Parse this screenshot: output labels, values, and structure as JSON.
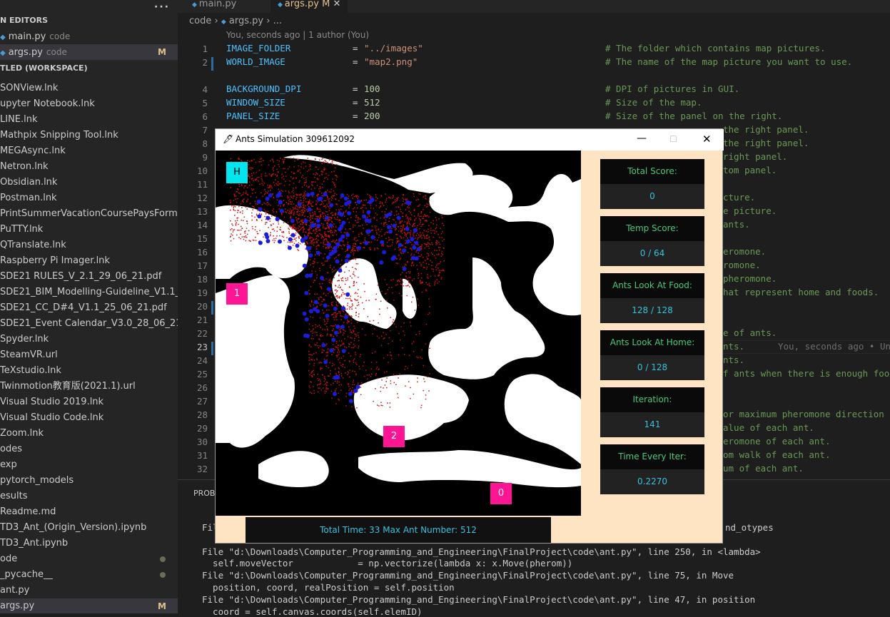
{
  "sidebar": {
    "section_open_editors": "N EDITORS",
    "section_workspace": "TLED (WORKSPACE)",
    "editors": [
      {
        "name": "main.py",
        "dir": "code",
        "flag": ""
      },
      {
        "name": "args.py",
        "dir": "code",
        "flag": "M"
      }
    ],
    "files": [
      {
        "name": "SONView.lnk",
        "mark": ""
      },
      {
        "name": "upyter Notebook.lnk",
        "mark": ""
      },
      {
        "name": "LINE.lnk",
        "mark": ""
      },
      {
        "name": "Mathpix Snipping Tool.lnk",
        "mark": ""
      },
      {
        "name": "MEGAsync.lnk",
        "mark": ""
      },
      {
        "name": "Netron.lnk",
        "mark": ""
      },
      {
        "name": "Obsidian.lnk",
        "mark": ""
      },
      {
        "name": "Postman.lnk",
        "mark": ""
      },
      {
        "name": "PrintSummerVacationCoursePaysForm.pdf",
        "mark": ""
      },
      {
        "name": "PuTTY.lnk",
        "mark": ""
      },
      {
        "name": "QTranslate.lnk",
        "mark": ""
      },
      {
        "name": "Raspberry Pi Imager.lnk",
        "mark": ""
      },
      {
        "name": "SDE21 RULES_V_2.1_29_06_21.pdf",
        "mark": ""
      },
      {
        "name": "SDE21_BIM_Modelling-Guideline_V1.1_25_...",
        "mark": ""
      },
      {
        "name": "SDE21_CC_D#4_V1.1_25_06_21.pdf",
        "mark": ""
      },
      {
        "name": "SDE21_Event Calendar_V3.0_28_06_21.pdf",
        "mark": ""
      },
      {
        "name": "Spyder.lnk",
        "mark": ""
      },
      {
        "name": "SteamVR.url",
        "mark": ""
      },
      {
        "name": "TeXstudio.lnk",
        "mark": ""
      },
      {
        "name": "Twinmotion教育版(2021.1).url",
        "mark": ""
      },
      {
        "name": "Visual Studio 2019.lnk",
        "mark": ""
      },
      {
        "name": "Visual Studio Code.lnk",
        "mark": ""
      },
      {
        "name": "Zoom.lnk",
        "mark": ""
      },
      {
        "name": "odes",
        "mark": ""
      },
      {
        "name": "exp",
        "mark": ""
      },
      {
        "name": "pytorch_models",
        "mark": ""
      },
      {
        "name": "esults",
        "mark": ""
      },
      {
        "name": "Readme.md",
        "mark": ""
      },
      {
        "name": "TD3_Ant_(Origin_Version).ipynb",
        "mark": ""
      },
      {
        "name": "TD3_Ant.ipynb",
        "mark": ""
      },
      {
        "name": "ode",
        "mark": "dot"
      },
      {
        "name": "_pycache__",
        "mark": "dot"
      },
      {
        "name": "ant.py",
        "mark": ""
      },
      {
        "name": "args.py",
        "mark": "M"
      }
    ]
  },
  "tabs": [
    {
      "label": "main.py"
    },
    {
      "label": "args.py  M"
    }
  ],
  "breadcrumb": {
    "folder": "code",
    "file": "args.py",
    "rest": "..."
  },
  "blame": "You, seconds ago | 1 author (You)",
  "code_lines": [
    {
      "n": "1",
      "var": "IMAGE_FOLDER",
      "val": "\"../images\"",
      "type": "str",
      "comment": "# The folder which contains map pictures."
    },
    {
      "n": "2",
      "var": "WORLD_IMAGE",
      "val": "\"map2.png\"",
      "type": "str",
      "comment": "# The name of the map picture you want to use."
    },
    {
      "n": "4",
      "var": "BACKGROUND_DPI",
      "val": "100",
      "type": "num",
      "comment": "# DPI of pictures in GUI."
    },
    {
      "n": "5",
      "var": "WINDOW_SIZE",
      "val": "512",
      "type": "num",
      "comment": "# Size of the map."
    },
    {
      "n": "6",
      "var": "PANEL_SIZE",
      "val": "200",
      "type": "num",
      "comment": "# Size of the panel on the right."
    }
  ],
  "right_comments": [
    "the right panel.",
    "the right panel.",
    "right panel.",
    "tom panel.",
    "cture.",
    "e picture.",
    "ants.",
    "eromone.",
    "romone.",
    "pheromone.",
    "hat represent home and foods.",
    "e of ants.",
    "nts.",
    "nts.",
    "f ants when there is enough foo",
    "or maximum pheromone direction",
    "alue of each ant.",
    "eromone of each ant.",
    "om walk of each ant.",
    "um of each ant."
  ],
  "inline_blame": "You, seconds ago • Un",
  "line_numbers_extra": [
    "7",
    "8",
    "9",
    "10",
    "11",
    "12",
    "13",
    "14",
    "15",
    "16",
    "17",
    "18",
    "19",
    "20",
    "21",
    "22",
    "23",
    "24",
    "25",
    "26",
    "27",
    "28",
    "29",
    "30",
    "31",
    "32"
  ],
  "terminal": {
    "tab": "PROBL",
    "lines": [
      "File",
      "File \"d:\\Downloads\\Computer_Programming_and_Engineering\\FinalProject\\code\\ant.py\", line 250, in <lambda>",
      "  self.moveVector            = np.vectorize(lambda x: x.Move(pherom))",
      "File \"d:\\Downloads\\Computer_Programming_and_Engineering\\FinalProject\\code\\ant.py\", line 75, in Move",
      "  position, coord, realPosition = self.position",
      "File \"d:\\Downloads\\Computer_Programming_and_Engineering\\FinalProject\\code\\ant.py\", line 47, in position",
      "  coord = self.canvas.coords(self.elemID)"
    ],
    "right_fragment": "nd_otypes"
  },
  "sim": {
    "title": "Ants Simulation 309612092",
    "labels": {
      "home": "H",
      "food1": "1",
      "food2": "2",
      "food0": "0"
    },
    "stats": [
      {
        "label": "Total Score:",
        "value": "0"
      },
      {
        "label": "Temp Score:",
        "value": "0 / 64"
      },
      {
        "label": "Ants Look At Food:",
        "value": "128 / 128"
      },
      {
        "label": "Ants Look At Home:",
        "value": "0 / 128"
      },
      {
        "label": "Iteration:",
        "value": "141"
      },
      {
        "label": "Time Every Iter:",
        "value": "0.2270"
      }
    ],
    "bottom": "Total Time: 33   Max Ant Number: 512"
  },
  "colors": {
    "accent": "#e2c08d",
    "pheromone": "#d01414",
    "ant": "#1c1cd8",
    "marker": "#ff1493",
    "home": "#00e5ee",
    "panel_bg": "#ffe4c4"
  }
}
